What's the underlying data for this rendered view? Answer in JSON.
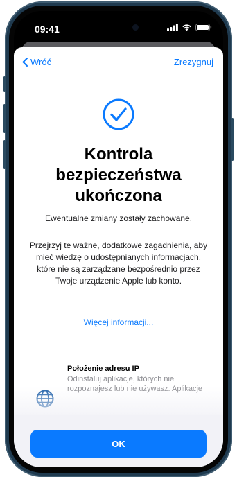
{
  "status_bar": {
    "time": "09:41",
    "signal_icon": "cellular-signal-icon",
    "wifi_icon": "wifi-icon",
    "battery_icon": "battery-icon"
  },
  "nav": {
    "back_label": "Wróć",
    "cancel_label": "Zrezygnuj"
  },
  "header": {
    "icon": "checkmark-circle-icon",
    "title": "Kontrola bezpieczeństwa ukończona",
    "subtitle": "Ewentualne zmiany zostały zachowane."
  },
  "body": {
    "text": "Przejrzyj te ważne, dodatkowe zagadnienia, aby mieć wiedzę o udostępnianych informacjach, które nie są zarządzane bezpośrednio przez Twoje urządzenie Apple lub konto.",
    "more_link": "Więcej informacji..."
  },
  "ip_section": {
    "icon": "globe-icon",
    "title": "Położenie adresu IP",
    "description": "Odinstaluj aplikacje, których nie rozpoznajesz lub nie używasz. Aplikacje"
  },
  "footer": {
    "ok_label": "OK"
  },
  "colors": {
    "accent": "#0a7aff",
    "frame": "#1f3a4f"
  }
}
